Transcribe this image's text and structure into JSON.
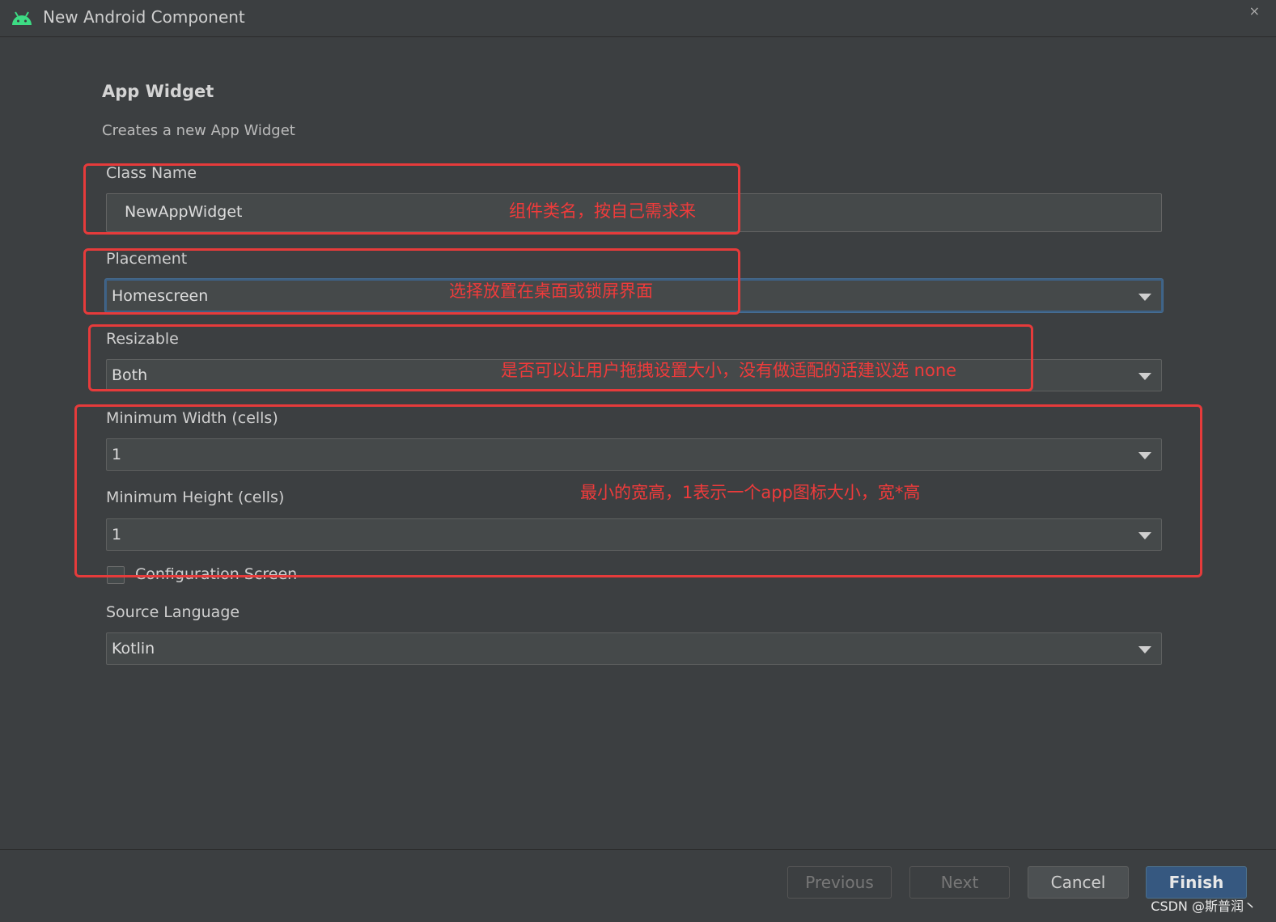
{
  "window": {
    "title": "New Android Component",
    "icon": "android-icon",
    "close_glyph": "×"
  },
  "header": {
    "title": "App Widget",
    "description": "Creates a new App Widget"
  },
  "form": {
    "class_name": {
      "label": "Class Name",
      "value": "NewAppWidget"
    },
    "placement": {
      "label": "Placement",
      "value": "Homescreen"
    },
    "resizable": {
      "label": "Resizable",
      "value": "Both"
    },
    "min_width": {
      "label": "Minimum Width (cells)",
      "value": "1"
    },
    "min_height": {
      "label": "Minimum Height (cells)",
      "value": "1"
    },
    "configuration_screen": {
      "label": "Configuration Screen",
      "checked": false
    },
    "source_language": {
      "label": "Source Language",
      "value": "Kotlin"
    }
  },
  "annotations": {
    "class_name_note": "组件类名，按自己需求来",
    "placement_note": "选择放置在桌面或锁屏界面",
    "resizable_note": "是否可以让用户拖拽设置大小，没有做适配的话建议选 none",
    "size_note": "最小的宽高，1表示一个app图标大小，宽*高"
  },
  "footer": {
    "previous_label": "Previous",
    "next_label": "Next",
    "cancel_label": "Cancel",
    "finish_label": "Finish"
  },
  "watermark": "CSDN @斯普润丶",
  "colors": {
    "annotation": "#e63b3b",
    "primary_button": "#365880",
    "background": "#3c3f41",
    "android_green": "#3ddc84"
  }
}
